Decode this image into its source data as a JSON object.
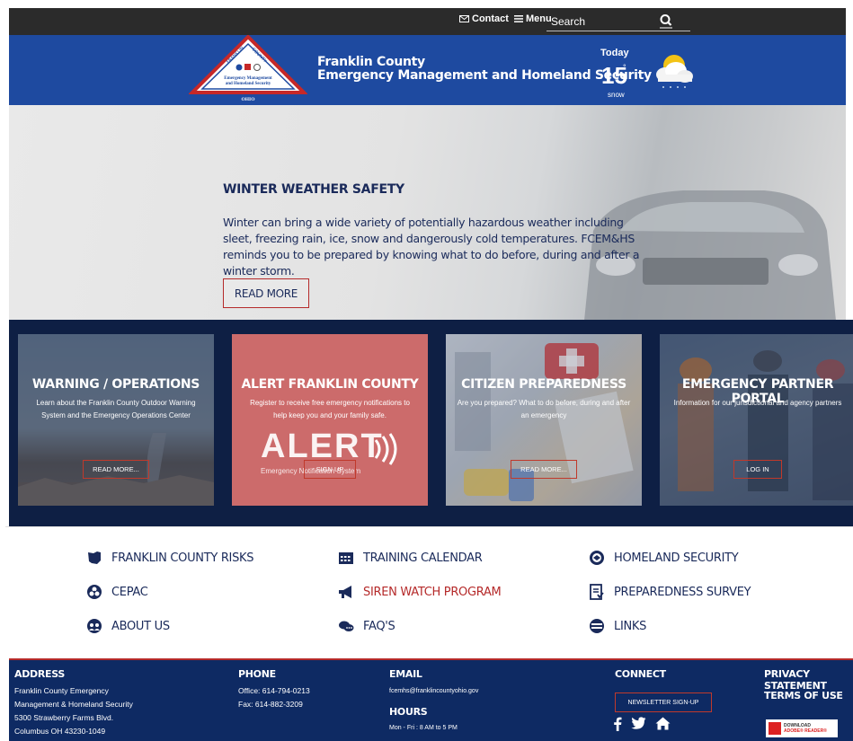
{
  "topbar": {
    "contact_label": "Contact",
    "menu_label": "Menu",
    "search_placeholder": "Search"
  },
  "header": {
    "logo_text": {
      "top": "FRANKLIN COUNTY",
      "line1": "Emergency Management",
      "line2": "and Homeland Security",
      "bottom": "OHIO"
    },
    "agency_line1": "Franklin County",
    "agency_line2": "Emergency Management and Homeland Security",
    "weather": {
      "today": "Today",
      "temp": "15",
      "degree": "°",
      "condition": "snow"
    }
  },
  "hero": {
    "title": "WINTER WEATHER SAFETY",
    "text": "Winter can bring a wide variety of potentially hazardous weather including sleet, freezing rain, ice, snow and dangerously cold temperatures.  FCEM&HS reminds you to be prepared by knowing what to do before, during and after a winter storm.",
    "button": "READ MORE"
  },
  "cards": [
    {
      "title": "WARNING / OPERATIONS",
      "desc": "Learn about the Franklin County Outdoor Warning System and the Emergency Operations Center",
      "button": "READ MORE..."
    },
    {
      "title": "ALERT FRANKLIN COUNTY",
      "desc": "Register to receive free emergency notifications to help keep you and your family safe.",
      "button": "SIGN UP",
      "graphic": "ALERT",
      "graphic_sub": "Emergency Notification System"
    },
    {
      "title": "CITIZEN PREPAREDNESS",
      "desc": "Are you prepared? What to do before, during and after an emergency",
      "button": "READ MORE..."
    },
    {
      "title": "EMERGENCY PARTNER PORTAL",
      "desc": "Information for our jurisdictional and agency partners",
      "button": "LOG IN"
    }
  ],
  "quick_links": [
    {
      "label": "FRANKLIN COUNTY RISKS",
      "icon": "ohio-map-icon"
    },
    {
      "label": "TRAINING CALENDAR",
      "icon": "calendar-icon"
    },
    {
      "label": "HOMELAND SECURITY",
      "icon": "seal-icon"
    },
    {
      "label": "CEPAC",
      "icon": "biohazard-icon"
    },
    {
      "label": "SIREN WATCH PROGRAM",
      "icon": "megaphone-icon",
      "color": "#b52a2a"
    },
    {
      "label": "PREPAREDNESS SURVEY",
      "icon": "survey-icon"
    },
    {
      "label": "ABOUT US",
      "icon": "group-icon"
    },
    {
      "label": "FAQ'S",
      "icon": "chat-icon"
    },
    {
      "label": "LINKS",
      "icon": "globe-icon"
    }
  ],
  "footer": {
    "address_heading": "ADDRESS",
    "address_lines": [
      "Franklin County Emergency",
      "Management & Homeland Security",
      "5300 Strawberry Farms Blvd.",
      "Columbus OH 43230-1049"
    ],
    "phone_heading": "PHONE",
    "phone_lines": [
      "Office: 614-794-0213",
      "Fax: 614-882-3209"
    ],
    "email_heading": "EMAIL",
    "email": "fcemhs@franklincountyohio.gov",
    "hours_heading": "HOURS",
    "hours": "Mon - Fri : 8 AM to 5 PM",
    "connect_heading": "CONNECT",
    "newsletter": "NEWSLETTER SIGN-UP",
    "privacy": "PRIVACY STATEMENT",
    "terms": "TERMS OF USE",
    "adobe_line1": "DOWNLOAD",
    "adobe_line2": "ADOBE® READER®"
  },
  "colors": {
    "header_blue": "#1e4aa0",
    "navy": "#0e1f44",
    "footer_blue": "#0e2a63",
    "accent_red": "#b52a2a",
    "alert_card": "#cc6b6b"
  }
}
